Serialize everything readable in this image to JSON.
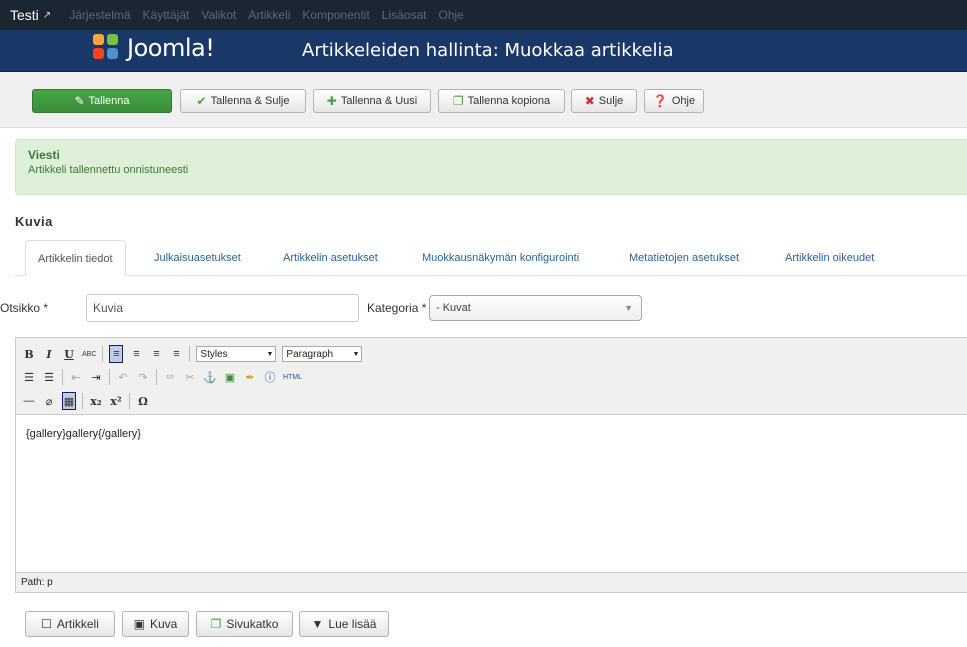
{
  "topnav": {
    "brand": "Testi",
    "brand_icon": "external-link-icon",
    "items": [
      "Järjestelmä",
      "Käyttäjät",
      "Valikot",
      "Artikkeli",
      "Komponentit",
      "Lisäosat",
      "Ohje"
    ]
  },
  "header": {
    "logo_text": "Joomla!",
    "title": "Artikkeleiden hallinta: Muokkaa artikkelia"
  },
  "toolbar": {
    "save": "Tallenna",
    "save_close": "Tallenna & Sulje",
    "save_new": "Tallenna & Uusi",
    "save_copy": "Tallenna kopiona",
    "close": "Sulje",
    "help": "Ohje"
  },
  "message": {
    "title": "Viesti",
    "text": "Artikkeli tallennettu onnistuneesti"
  },
  "section_title": "Kuvia",
  "tabs": [
    "Artikkelin tiedot",
    "Julkaisuasetukset",
    "Artikkelin asetukset",
    "Muokkausnäkymän konfigurointi",
    "Metatietojen asetukset",
    "Artikkelin oikeudet"
  ],
  "form": {
    "title_label": "Otsikko *",
    "title_value": "Kuvia",
    "category_label": "Kategoria *",
    "category_value": "- Kuvat"
  },
  "editor": {
    "styles_dropdown": "Styles",
    "format_dropdown": "Paragraph",
    "html_label": "HTML",
    "abc_label": "ABC",
    "content": "{gallery}gallery{/gallery}",
    "path": "Path: p"
  },
  "buttons": {
    "article": "Artikkeli",
    "image": "Kuva",
    "pagebreak": "Sivukatko",
    "readmore": "Lue lisää"
  },
  "colors": {
    "topnav_bg": "#1b2633",
    "header_bg": "#1a3867",
    "save_green": "#46a546",
    "message_bg": "#dff0d8",
    "link_blue": "#2a6496"
  }
}
